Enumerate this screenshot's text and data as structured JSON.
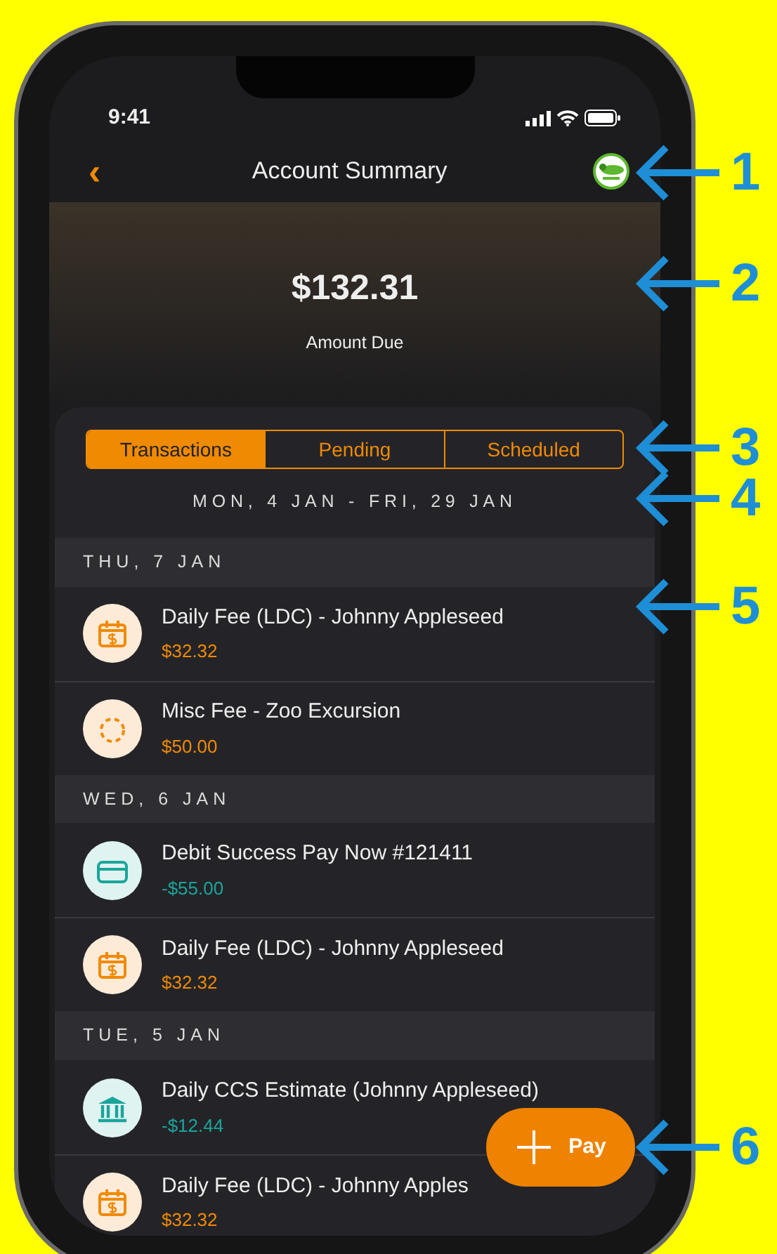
{
  "status_bar": {
    "time": "9:41"
  },
  "nav": {
    "back": "‹",
    "title": "Account Summary"
  },
  "summary": {
    "amount": "$132.31",
    "label": "Amount Due"
  },
  "tabs": [
    {
      "label": "Transactions",
      "selected": true
    },
    {
      "label": "Pending",
      "selected": false
    },
    {
      "label": "Scheduled",
      "selected": false
    }
  ],
  "date_range": "MON, 4 JAN - FRI, 29 JAN",
  "groups": [
    {
      "date": "THU, 7 JAN",
      "transactions": [
        {
          "kind": "fee",
          "title": "Daily Fee (LDC) - Johnny Appleseed",
          "amount": "$32.32"
        },
        {
          "kind": "misc",
          "title": "Misc Fee - Zoo Excursion",
          "amount": "$50.00"
        }
      ]
    },
    {
      "date": "WED, 6 JAN",
      "transactions": [
        {
          "kind": "payment",
          "title": "Debit Success Pay Now #121411",
          "amount": "-$55.00"
        },
        {
          "kind": "fee",
          "title": "Daily Fee (LDC) - Johnny Appleseed",
          "amount": "$32.32"
        }
      ]
    },
    {
      "date": "TUE, 5 JAN",
      "transactions": [
        {
          "kind": "subsidy",
          "title": "Daily CCS Estimate (Johnny Appleseed)",
          "amount": "-$12.44"
        },
        {
          "kind": "fee",
          "title": "Daily Fee (LDC) - Johnny Apples",
          "amount": "$32.32"
        }
      ]
    }
  ],
  "pay_button": {
    "label": "Pay"
  },
  "callouts": [
    {
      "label": "1"
    },
    {
      "label": "2"
    },
    {
      "label": "3"
    },
    {
      "label": "4"
    },
    {
      "label": "5"
    },
    {
      "label": "6"
    }
  ]
}
